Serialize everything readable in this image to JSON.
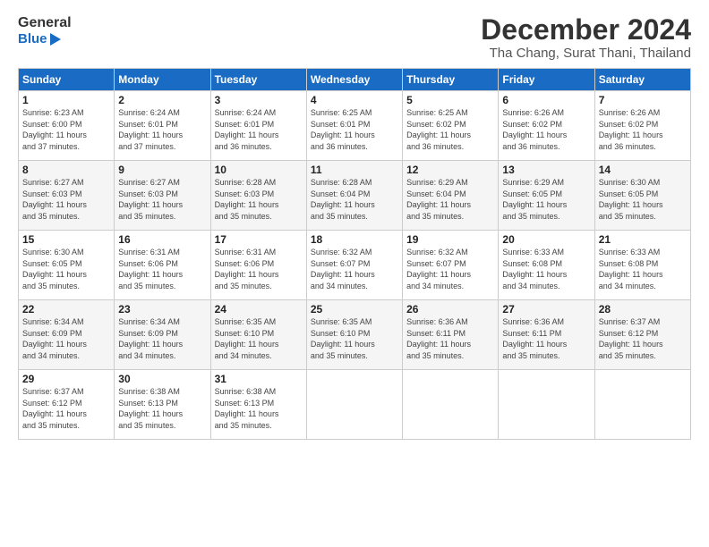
{
  "header": {
    "logo_general": "General",
    "logo_blue": "Blue",
    "month": "December 2024",
    "location": "Tha Chang, Surat Thani, Thailand"
  },
  "days_of_week": [
    "Sunday",
    "Monday",
    "Tuesday",
    "Wednesday",
    "Thursday",
    "Friday",
    "Saturday"
  ],
  "weeks": [
    [
      {
        "day": "1",
        "info": "Sunrise: 6:23 AM\nSunset: 6:00 PM\nDaylight: 11 hours\nand 37 minutes."
      },
      {
        "day": "2",
        "info": "Sunrise: 6:24 AM\nSunset: 6:01 PM\nDaylight: 11 hours\nand 37 minutes."
      },
      {
        "day": "3",
        "info": "Sunrise: 6:24 AM\nSunset: 6:01 PM\nDaylight: 11 hours\nand 36 minutes."
      },
      {
        "day": "4",
        "info": "Sunrise: 6:25 AM\nSunset: 6:01 PM\nDaylight: 11 hours\nand 36 minutes."
      },
      {
        "day": "5",
        "info": "Sunrise: 6:25 AM\nSunset: 6:02 PM\nDaylight: 11 hours\nand 36 minutes."
      },
      {
        "day": "6",
        "info": "Sunrise: 6:26 AM\nSunset: 6:02 PM\nDaylight: 11 hours\nand 36 minutes."
      },
      {
        "day": "7",
        "info": "Sunrise: 6:26 AM\nSunset: 6:02 PM\nDaylight: 11 hours\nand 36 minutes."
      }
    ],
    [
      {
        "day": "8",
        "info": "Sunrise: 6:27 AM\nSunset: 6:03 PM\nDaylight: 11 hours\nand 35 minutes."
      },
      {
        "day": "9",
        "info": "Sunrise: 6:27 AM\nSunset: 6:03 PM\nDaylight: 11 hours\nand 35 minutes."
      },
      {
        "day": "10",
        "info": "Sunrise: 6:28 AM\nSunset: 6:03 PM\nDaylight: 11 hours\nand 35 minutes."
      },
      {
        "day": "11",
        "info": "Sunrise: 6:28 AM\nSunset: 6:04 PM\nDaylight: 11 hours\nand 35 minutes."
      },
      {
        "day": "12",
        "info": "Sunrise: 6:29 AM\nSunset: 6:04 PM\nDaylight: 11 hours\nand 35 minutes."
      },
      {
        "day": "13",
        "info": "Sunrise: 6:29 AM\nSunset: 6:05 PM\nDaylight: 11 hours\nand 35 minutes."
      },
      {
        "day": "14",
        "info": "Sunrise: 6:30 AM\nSunset: 6:05 PM\nDaylight: 11 hours\nand 35 minutes."
      }
    ],
    [
      {
        "day": "15",
        "info": "Sunrise: 6:30 AM\nSunset: 6:05 PM\nDaylight: 11 hours\nand 35 minutes."
      },
      {
        "day": "16",
        "info": "Sunrise: 6:31 AM\nSunset: 6:06 PM\nDaylight: 11 hours\nand 35 minutes."
      },
      {
        "day": "17",
        "info": "Sunrise: 6:31 AM\nSunset: 6:06 PM\nDaylight: 11 hours\nand 35 minutes."
      },
      {
        "day": "18",
        "info": "Sunrise: 6:32 AM\nSunset: 6:07 PM\nDaylight: 11 hours\nand 34 minutes."
      },
      {
        "day": "19",
        "info": "Sunrise: 6:32 AM\nSunset: 6:07 PM\nDaylight: 11 hours\nand 34 minutes."
      },
      {
        "day": "20",
        "info": "Sunrise: 6:33 AM\nSunset: 6:08 PM\nDaylight: 11 hours\nand 34 minutes."
      },
      {
        "day": "21",
        "info": "Sunrise: 6:33 AM\nSunset: 6:08 PM\nDaylight: 11 hours\nand 34 minutes."
      }
    ],
    [
      {
        "day": "22",
        "info": "Sunrise: 6:34 AM\nSunset: 6:09 PM\nDaylight: 11 hours\nand 34 minutes."
      },
      {
        "day": "23",
        "info": "Sunrise: 6:34 AM\nSunset: 6:09 PM\nDaylight: 11 hours\nand 34 minutes."
      },
      {
        "day": "24",
        "info": "Sunrise: 6:35 AM\nSunset: 6:10 PM\nDaylight: 11 hours\nand 34 minutes."
      },
      {
        "day": "25",
        "info": "Sunrise: 6:35 AM\nSunset: 6:10 PM\nDaylight: 11 hours\nand 35 minutes."
      },
      {
        "day": "26",
        "info": "Sunrise: 6:36 AM\nSunset: 6:11 PM\nDaylight: 11 hours\nand 35 minutes."
      },
      {
        "day": "27",
        "info": "Sunrise: 6:36 AM\nSunset: 6:11 PM\nDaylight: 11 hours\nand 35 minutes."
      },
      {
        "day": "28",
        "info": "Sunrise: 6:37 AM\nSunset: 6:12 PM\nDaylight: 11 hours\nand 35 minutes."
      }
    ],
    [
      {
        "day": "29",
        "info": "Sunrise: 6:37 AM\nSunset: 6:12 PM\nDaylight: 11 hours\nand 35 minutes."
      },
      {
        "day": "30",
        "info": "Sunrise: 6:38 AM\nSunset: 6:13 PM\nDaylight: 11 hours\nand 35 minutes."
      },
      {
        "day": "31",
        "info": "Sunrise: 6:38 AM\nSunset: 6:13 PM\nDaylight: 11 hours\nand 35 minutes."
      },
      null,
      null,
      null,
      null
    ]
  ]
}
